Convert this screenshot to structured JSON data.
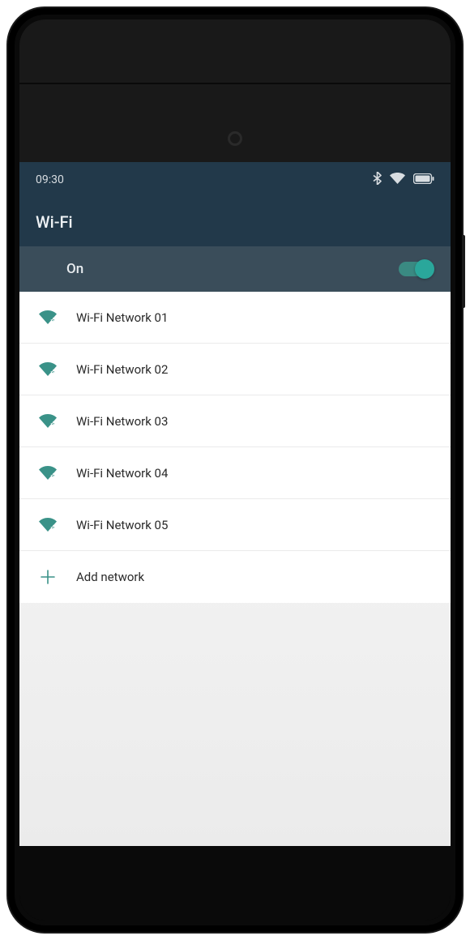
{
  "statusBar": {
    "time": "09:30"
  },
  "header": {
    "title": "Wi-Fi"
  },
  "toggle": {
    "label": "On",
    "state": true
  },
  "networks": [
    {
      "name": "Wi-Fi Network 01"
    },
    {
      "name": "Wi-Fi Network 02"
    },
    {
      "name": "Wi-Fi Network 03"
    },
    {
      "name": "Wi-Fi Network 04"
    },
    {
      "name": "Wi-Fi Network 05"
    }
  ],
  "addNetwork": {
    "label": "Add network"
  },
  "colors": {
    "accent": "#2aa79b",
    "headerBg": "#22394a",
    "toggleRowBg": "#3a4d5a"
  }
}
